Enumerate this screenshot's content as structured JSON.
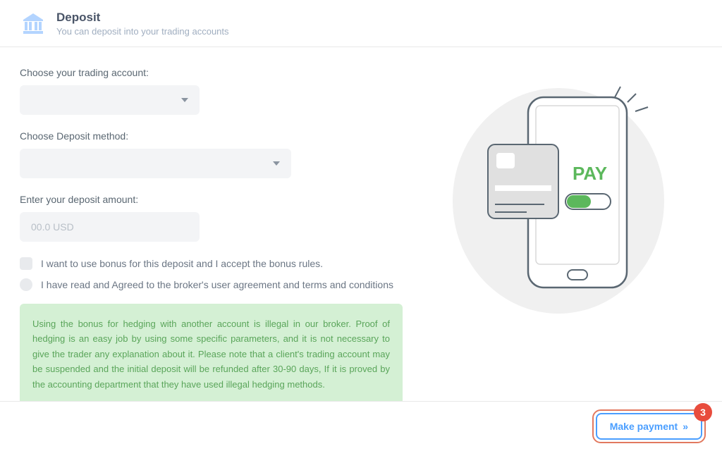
{
  "header": {
    "title": "Deposit",
    "subtitle": "You can deposit into your trading accounts"
  },
  "form": {
    "account_label": "Choose your trading account:",
    "method_label": "Choose Deposit method:",
    "amount_label": "Enter your deposit amount:",
    "amount_placeholder": "00.0 USD",
    "bonus_checkbox": "I want to use bonus for this deposit and I accept the bonus rules.",
    "terms_checkbox": "I have read and Agreed to the broker's user agreement and terms and conditions"
  },
  "notice": "Using the bonus for hedging with another account is illegal in our broker. Proof of hedging is an easy job by using some specific parameters, and it is not necessary to give the trader any explanation about it. Please note that a client's trading account may be suspended and the initial deposit will be refunded after 30-90 days, If it is proved by the accounting department that they have used illegal hedging methods.",
  "illustration": {
    "pay_text": "PAY"
  },
  "footer": {
    "button_label": "Make payment",
    "badge": "3"
  }
}
